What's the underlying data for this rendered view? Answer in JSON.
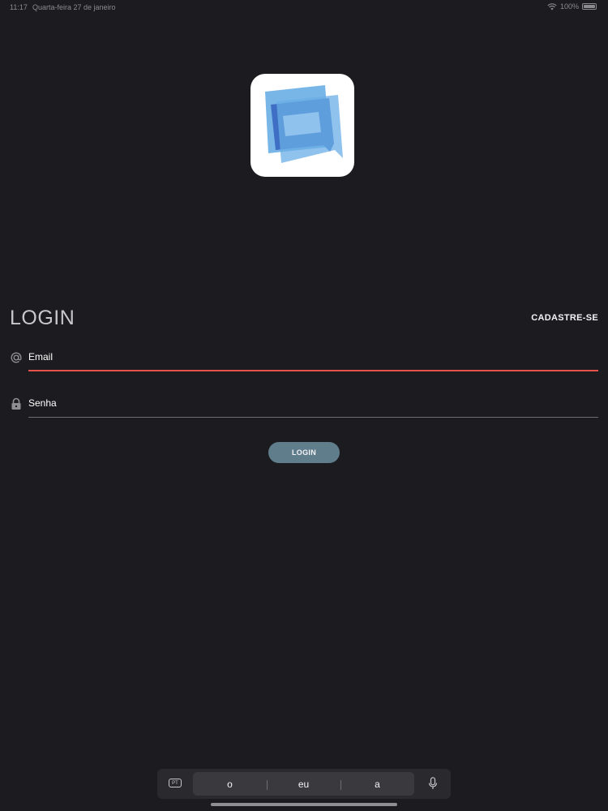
{
  "status_bar": {
    "time": "11:17",
    "date": "Quarta-feira 27 de janeiro",
    "battery": "100%"
  },
  "app": {
    "logo_icon": "chat-bubbles-logo",
    "brand_colors": {
      "light_blue": "#6aaee6",
      "dark_blue": "#3f6fc4"
    }
  },
  "login": {
    "title": "LOGIN",
    "signup_label": "CADASTRE-SE",
    "email": {
      "icon": "at-sign-icon",
      "placeholder": "Email",
      "value": ""
    },
    "password": {
      "icon": "lock-icon",
      "placeholder": "Senha",
      "value": ""
    },
    "button_label": "LOGIN"
  },
  "keyboard": {
    "language": "PT",
    "suggestions": [
      "o",
      "eu",
      "a"
    ],
    "mic_icon": "microphone-icon"
  },
  "colors": {
    "background": "#1c1c20",
    "error_underline": "#e5534b",
    "button": "#607d8b"
  }
}
